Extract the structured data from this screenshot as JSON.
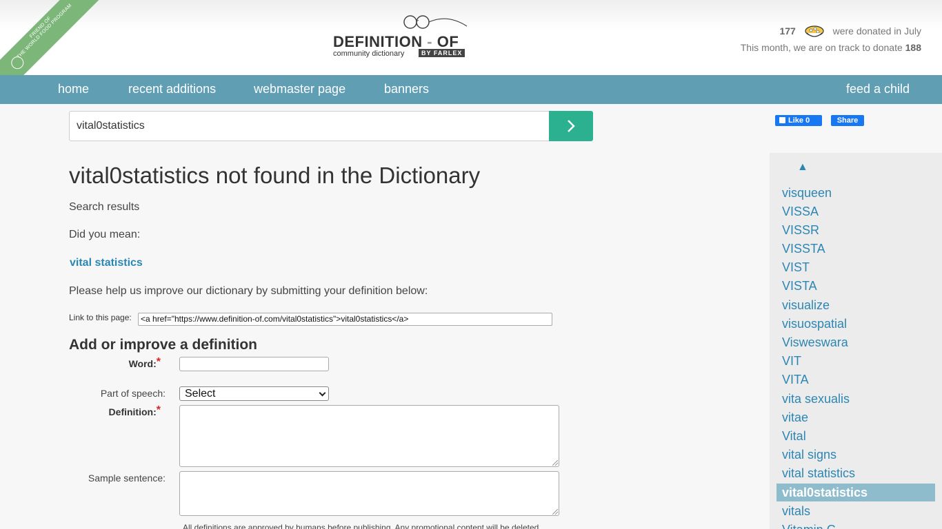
{
  "ribbon": {
    "line1": "FRIEND OF",
    "line2": "THE WORLD FOOD PROGRAM"
  },
  "logo": {
    "title_main": "DEFINITION",
    "title_dash": "-",
    "title_of": "OF",
    "subtitle": "community dictionary",
    "farlex": "BY FARLEX"
  },
  "donate": {
    "count": "177",
    "line1_text": "were donated in July",
    "line2_text": "This month, we are on track to donate",
    "projected": "188"
  },
  "nav": {
    "home": "home",
    "recent": "recent additions",
    "webmaster": "webmaster page",
    "banners": "banners",
    "feed": "feed a child"
  },
  "search": {
    "value": "vital0statistics"
  },
  "main": {
    "title": "vital0statistics not found in the Dictionary",
    "search_results": "Search results",
    "did_you_mean": "Did you mean:",
    "suggestion": "vital statistics",
    "help_text": "Please help us improve our dictionary by submitting your definition below:",
    "link_label": "Link to this page:",
    "link_value": "<a href=\"https://www.definition-of.com/vital0statistics\">vital0statistics</a>"
  },
  "form": {
    "title": "Add or improve a definition",
    "word_label": "Word:",
    "pos_label": "Part of speech:",
    "pos_selected": "Select",
    "definition_label": "Definition:",
    "sample_label": "Sample sentence:",
    "required_mark": "*",
    "note": "All definitions are approved by humans before publishing. Any promotional content will be deleted."
  },
  "social": {
    "like": "Like 0",
    "share": "Share"
  },
  "sidebar": {
    "up": "▲",
    "items": [
      "visqueen",
      "VISSA",
      "VISSR",
      "VISSTA",
      "VIST",
      "VISTA",
      "visualize",
      "visuospatial",
      "Visweswara",
      "VIT",
      "VITA",
      "vita sexualis",
      "vitae",
      "Vital",
      "vital signs",
      "vital statistics",
      "vital0statistics",
      "vitals",
      "Vitamin C"
    ],
    "active": "vital0statistics"
  },
  "colors": {
    "nav": "#5f9eb3",
    "search_button": "#2bb18f",
    "link": "#2c86b3",
    "active_item": "#8fbccc",
    "ribbon": "#7cb779"
  }
}
